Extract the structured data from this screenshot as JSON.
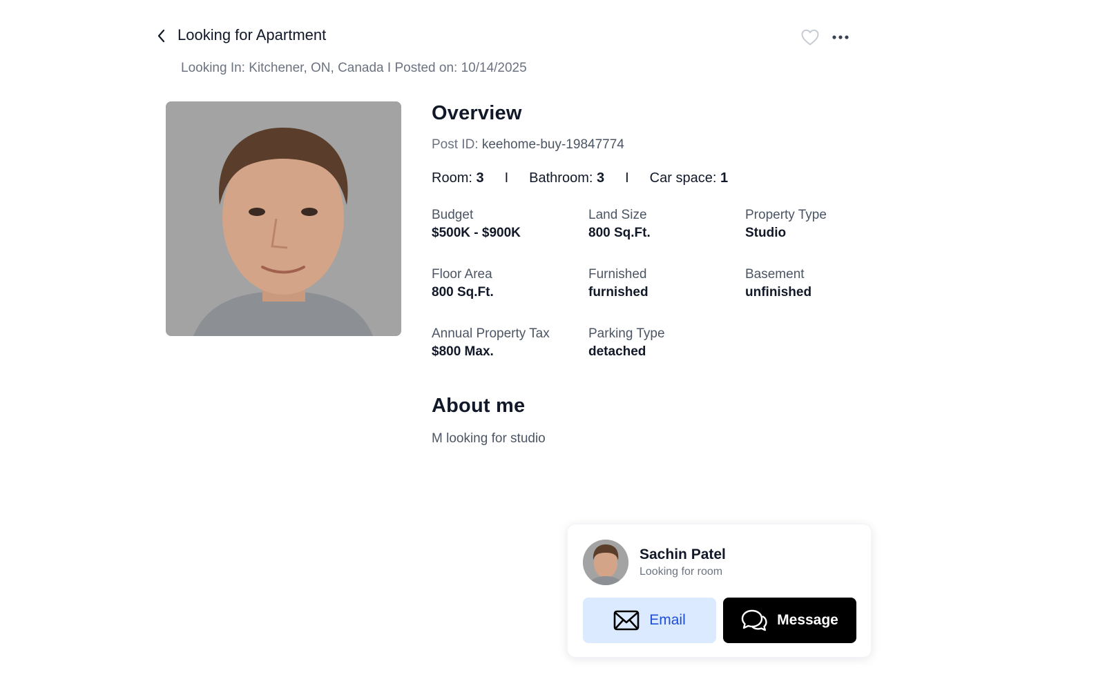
{
  "header": {
    "title": "Looking for Apartment",
    "subtitle": "Looking In: Kitchener, ON, Canada I Posted on: 10/14/2025"
  },
  "icons": {
    "back": "chevron-left-icon",
    "favorite": "heart-outline-icon",
    "more": "more-horizontal-icon",
    "email": "mail-icon",
    "message": "chat-bubbles-icon"
  },
  "overview": {
    "title": "Overview",
    "post_id_label": "Post ID:",
    "post_id": "keehome-buy-19847774",
    "rooms": [
      {
        "label": "Room:",
        "value": "3"
      },
      {
        "label": "Bathroom:",
        "value": "3"
      },
      {
        "label": "Car space:",
        "value": "1"
      }
    ],
    "separator": "I",
    "details": [
      {
        "label": "Budget",
        "value": "$500K - $900K"
      },
      {
        "label": "Land Size",
        "value": "800 Sq.Ft."
      },
      {
        "label": "Property Type",
        "value": "Studio"
      },
      {
        "label": "Floor Area",
        "value": "800 Sq.Ft."
      },
      {
        "label": "Furnished",
        "value": "furnished"
      },
      {
        "label": "Basement",
        "value": "unfinished"
      },
      {
        "label": "Annual Property Tax",
        "value": "$800 Max."
      },
      {
        "label": "Parking Type",
        "value": "detached"
      }
    ]
  },
  "about": {
    "title": "About me",
    "text": "M looking for studio"
  },
  "contact": {
    "name": "Sachin Patel",
    "subtitle": "Looking for room",
    "email_label": "Email",
    "message_label": "Message"
  },
  "colors": {
    "email_bg": "#dbeafe",
    "email_text": "#1d4ed8",
    "message_bg": "#000000",
    "text_muted": "#6b7280"
  }
}
